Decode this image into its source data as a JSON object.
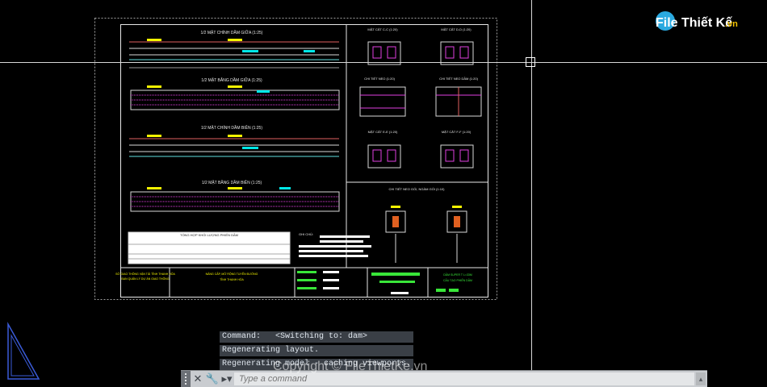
{
  "watermark": {
    "logo_text": "File Thiết Kế",
    "logo_suffix": ".vn",
    "footer": "Copyright © FileThietKe.vn"
  },
  "drawing": {
    "view_titles": [
      "1/2 MẶT CHÍNH DẦM GIỮA (1:25)",
      "1/2 MẶT BẰNG DẦM GIỮA (1:25)",
      "1/2 MẶT CHÍNH DẦM BIÊN (1:25)",
      "1/2 MẶT BẰNG DẦM BIÊN (1:25)"
    ],
    "section_titles": [
      "MẶT CẮT C-C (1:20)",
      "MẶT CẮT D-D (1:20)",
      "CHI TIẾT NEO (1:20)",
      "CHI TIẾT NEO DẦM (1:20)",
      "MẶT CẮT E-E (1:20)",
      "MẶT CẮT F-F (1:20)"
    ],
    "detail_title": "CHI TIẾT NEO GỐI, NGÀM GỐI (1:10)",
    "table_title": "TỔNG HỢP KHỐI LƯỢNG PHIẾN DẦM",
    "notes_title": "GHI CHÚ:",
    "title_block": {
      "org": [
        "SỞ GIAO THÔNG VẬN TẢI TỈNH THANH HÓA",
        "BAN QUẢN LÝ DỰ ÁN GIAO THÔNG"
      ],
      "project": [
        "NÂNG CẤP, MỞ RỘNG TUYẾN ĐƯỜNG",
        "TỈNH THANH HÓA"
      ],
      "sheet": [
        "DẦM SUPER T L=33M",
        "CẤU TẠO PHIẾN DẦM"
      ]
    },
    "accent_cyan": "#00e8e8",
    "accent_yellow": "#f5f500",
    "accent_green": "#39e639",
    "accent_magenta": "#e040e0"
  },
  "command_line": {
    "history": [
      "Command:   <Switching to: dam>",
      "Regenerating layout.",
      "Regenerating model - caching viewports."
    ],
    "placeholder": "Type a command",
    "close_icon": "close-icon",
    "settings_icon": "wrench-icon"
  }
}
